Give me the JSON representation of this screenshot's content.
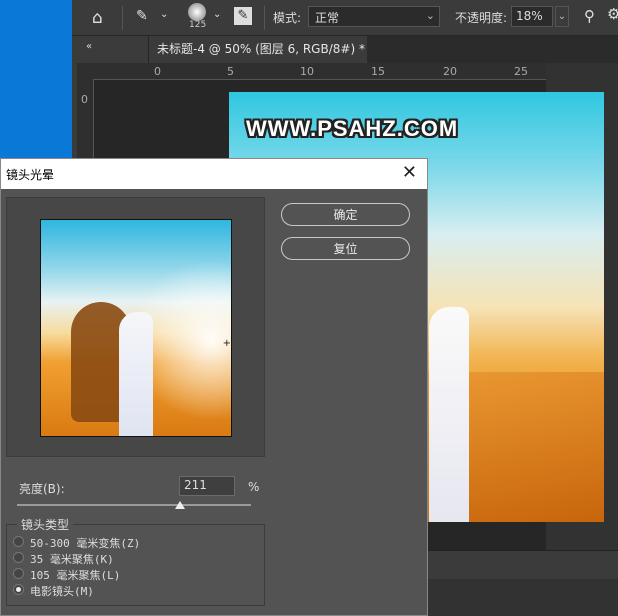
{
  "toolbar": {
    "brush_size": "125",
    "mode_label": "模式:",
    "mode_value": "正常",
    "opacity_label": "不透明度:",
    "opacity_value": "18%"
  },
  "document_tab": {
    "title": "未标题-4 @ 50% (图层 6, RGB/8#) *",
    "close": "×"
  },
  "ruler": {
    "h_ticks": [
      "0",
      "5",
      "10",
      "15",
      "20",
      "25"
    ],
    "v_ticks": [
      "0"
    ]
  },
  "watermark": "WWW.PSAHZ.COM",
  "dialog": {
    "title": "镜头光晕",
    "ok_label": "确定",
    "reset_label": "复位",
    "brightness_label": "亮度(B):",
    "brightness_value": "211",
    "brightness_unit": "%",
    "brightness_fraction": 0.7,
    "lens_type_title": "镜头类型",
    "lens_options": [
      {
        "label": "50-300 毫米变焦(Z)",
        "selected": false
      },
      {
        "label": "35 毫米聚焦(K)",
        "selected": false
      },
      {
        "label": "105 毫米聚焦(L)",
        "selected": false
      },
      {
        "label": "电影镜头(M)",
        "selected": true
      }
    ]
  }
}
